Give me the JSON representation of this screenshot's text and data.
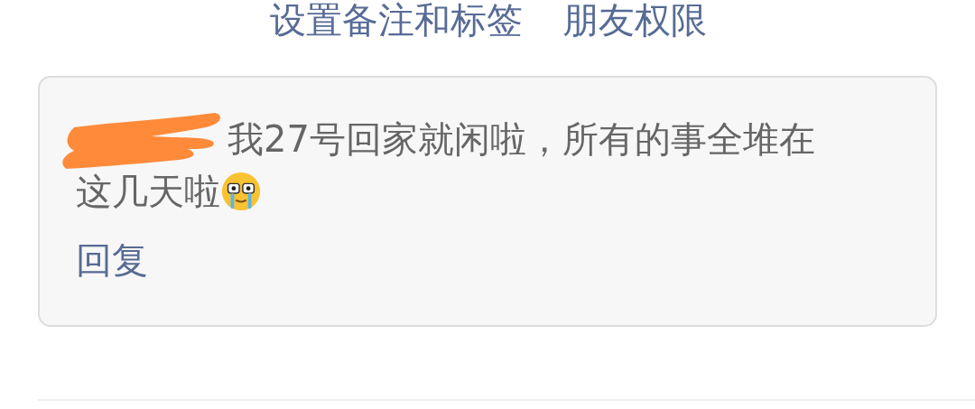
{
  "header_links": [
    {
      "label": "设置备注和标签"
    },
    {
      "label": "朋友权限"
    }
  ],
  "comment": {
    "author_redacted": true,
    "text_lines": [
      "我27号回家就闲啦，所有的事全堆在",
      "这几天啦"
    ],
    "reply": "回复"
  }
}
